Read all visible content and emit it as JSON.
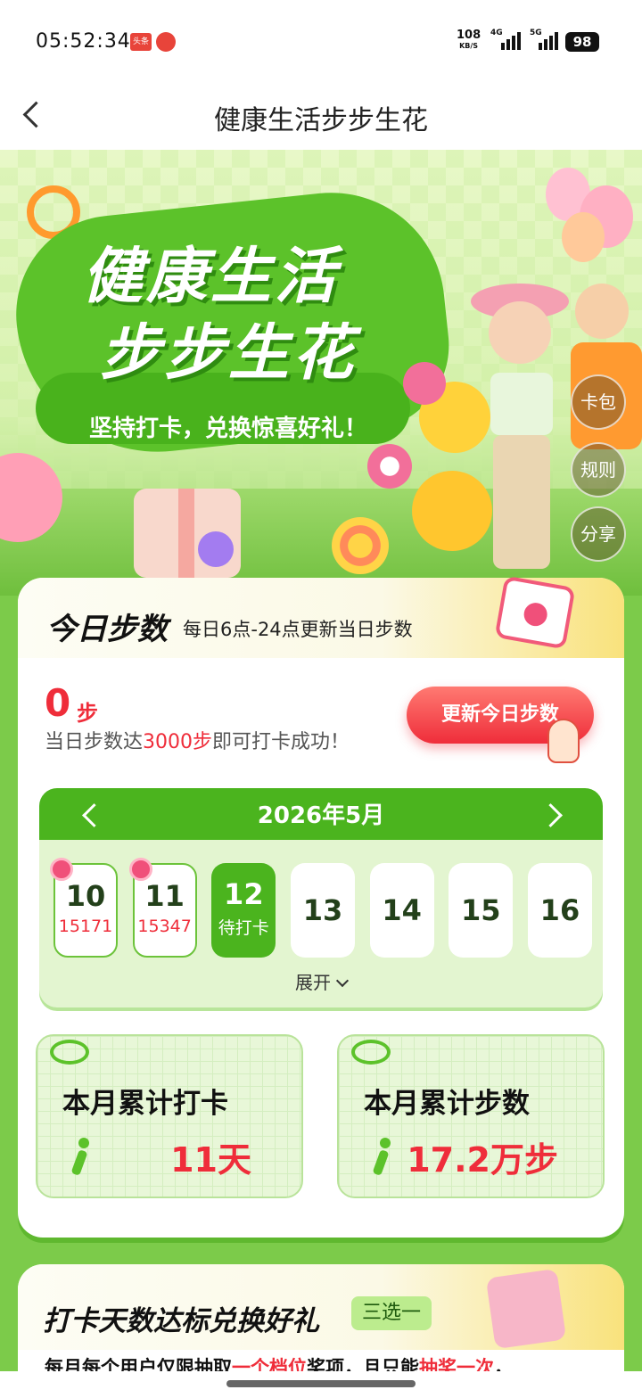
{
  "status_bar": {
    "time": "05:52:34",
    "app_badge": "头条",
    "speed": "108",
    "speed_unit": "KB/S",
    "signal1_label": "4G",
    "signal2_label": "5G",
    "battery": "98"
  },
  "nav": {
    "title": "健康生活步步生花",
    "back_icon": "chevron-left-icon"
  },
  "banner": {
    "title_line1": "健康生活",
    "title_line2": "步步生花",
    "subtitle": "坚持打卡，兑换惊喜好礼！",
    "side_buttons": [
      "卡包",
      "规则",
      "分享"
    ]
  },
  "today": {
    "title": "今日步数",
    "note": "每日6点-24点更新当日步数",
    "steps": "0",
    "steps_unit": "步",
    "desc_pre": "当日步数达",
    "desc_highlight": "3000步",
    "desc_post": "即可打卡成功！",
    "update_button": "更新今日步数"
  },
  "calendar": {
    "month": "2026年5月",
    "days": [
      {
        "day": "10",
        "sub": "15171",
        "state": "done"
      },
      {
        "day": "11",
        "sub": "15347",
        "state": "done"
      },
      {
        "day": "12",
        "sub": "待打卡",
        "state": "today"
      },
      {
        "day": "13",
        "sub": "",
        "state": "future"
      },
      {
        "day": "14",
        "sub": "",
        "state": "future"
      },
      {
        "day": "15",
        "sub": "",
        "state": "future"
      },
      {
        "day": "16",
        "sub": "",
        "state": "future"
      }
    ],
    "expand_label": "展开"
  },
  "stats": {
    "checkin_label": "本月累计打卡",
    "checkin_value": "11天",
    "steps_label": "本月累计步数",
    "steps_value": "17.2万步"
  },
  "rewards": {
    "title": "打卡天数达标兑换好礼",
    "pick_badge": "三选一",
    "rule_1": "每月每个用户仅限抽取",
    "rule_hl1": "一个档位",
    "rule_2": "奖项，且只能",
    "rule_hl2": "抽奖一次",
    "rule_3": "，"
  },
  "colors": {
    "accent_green": "#4bb41e",
    "highlight_red": "#ef2d3a"
  }
}
